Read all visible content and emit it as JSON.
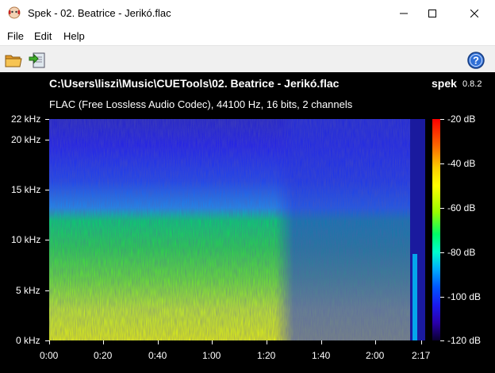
{
  "window": {
    "title": "Spek - 02. Beatrice - Jerikó.flac",
    "minimize_icon": "minimize-icon",
    "maximize_icon": "maximize-icon",
    "close_icon": "close-icon"
  },
  "menu": [
    "File",
    "Edit",
    "Help"
  ],
  "toolbar": {
    "open_icon": "folder-open-icon",
    "save_icon": "save-icon",
    "help_icon": "help-icon"
  },
  "header": {
    "file_path": "C:\\Users\\liszi\\Music\\CUETools\\02. Beatrice - Jerikó.flac",
    "app_name": "spek",
    "app_version": "0.8.2",
    "file_info": "FLAC (Free Lossless Audio Codec), 44100 Hz, 16 bits, 2 channels"
  },
  "freq_axis": [
    "22 kHz",
    "20 kHz",
    "15 kHz",
    "10 kHz",
    "5 kHz",
    "0 kHz"
  ],
  "time_axis": [
    "0:00",
    "0:20",
    "0:40",
    "1:00",
    "1:20",
    "1:40",
    "2:00",
    "2:17"
  ],
  "db_axis": [
    "-20 dB",
    "-40 dB",
    "-60 dB",
    "-80 dB",
    "-100 dB",
    "-120 dB"
  ],
  "colors": {
    "background": "#000000",
    "spectrogram_high": "#1e1ef0",
    "spectrogram_mid": "#00d95a",
    "spectrogram_low": "#e6ff00"
  }
}
